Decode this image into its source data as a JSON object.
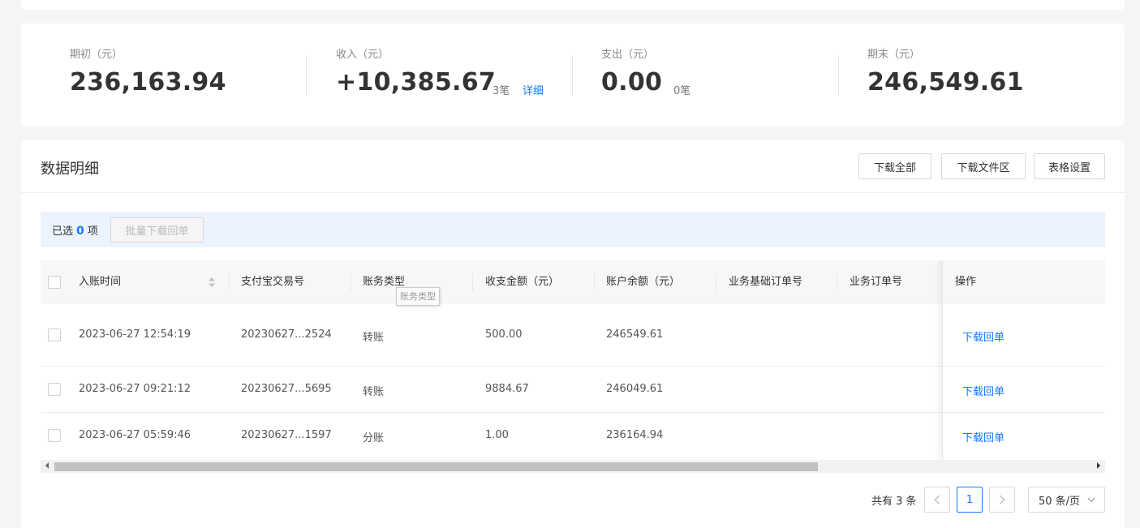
{
  "summary": {
    "opening": {
      "label": "期初（元）",
      "value": "236,163.94"
    },
    "income": {
      "label": "收入（元）",
      "value": "+10,385.67",
      "count": "3笔",
      "detail_link": "详细"
    },
    "expense": {
      "label": "支出（元）",
      "value": "0.00",
      "count": "0笔"
    },
    "closing": {
      "label": "期末（元）",
      "value": "246,549.61"
    }
  },
  "detail": {
    "title": "数据明细",
    "buttons": {
      "download_all": "下载全部",
      "download_files": "下载文件区",
      "table_settings": "表格设置"
    }
  },
  "selection": {
    "prefix": "已选",
    "count": "0",
    "suffix": "项",
    "batch_button": "批量下载回单"
  },
  "table": {
    "columns": [
      "入账时间",
      "支付宝交易号",
      "账务类型",
      "收支金额（元）",
      "账户余额（元）",
      "业务基础订单号",
      "业务订单号",
      "操作"
    ],
    "tooltip": "账务类型",
    "rows": [
      {
        "time": "2023-06-27 12:54:19",
        "trade_no": "20230627...2524",
        "type": "转账",
        "amount": "500.00",
        "balance": "246549.61",
        "base_order": "",
        "order": "",
        "action": "下载回单"
      },
      {
        "time": "2023-06-27 09:21:12",
        "trade_no": "20230627...5695",
        "type": "转账",
        "amount": "9884.67",
        "balance": "246049.61",
        "base_order": "",
        "order": "",
        "action": "下载回单"
      },
      {
        "time": "2023-06-27 05:59:46",
        "trade_no": "20230627...1597",
        "type": "分账",
        "amount": "1.00",
        "balance": "236164.94",
        "base_order": "",
        "order": "",
        "action": "下载回单"
      }
    ]
  },
  "pagination": {
    "total": "共有 3 条",
    "current_page": "1",
    "page_size": "50 条/页",
    "prev_icon": "chevron-left-icon",
    "next_icon": "chevron-right-icon"
  },
  "colors": {
    "accent": "#1677ff",
    "selbar_bg": "#ebf3fe",
    "page_bg": "#f5f5f5"
  }
}
